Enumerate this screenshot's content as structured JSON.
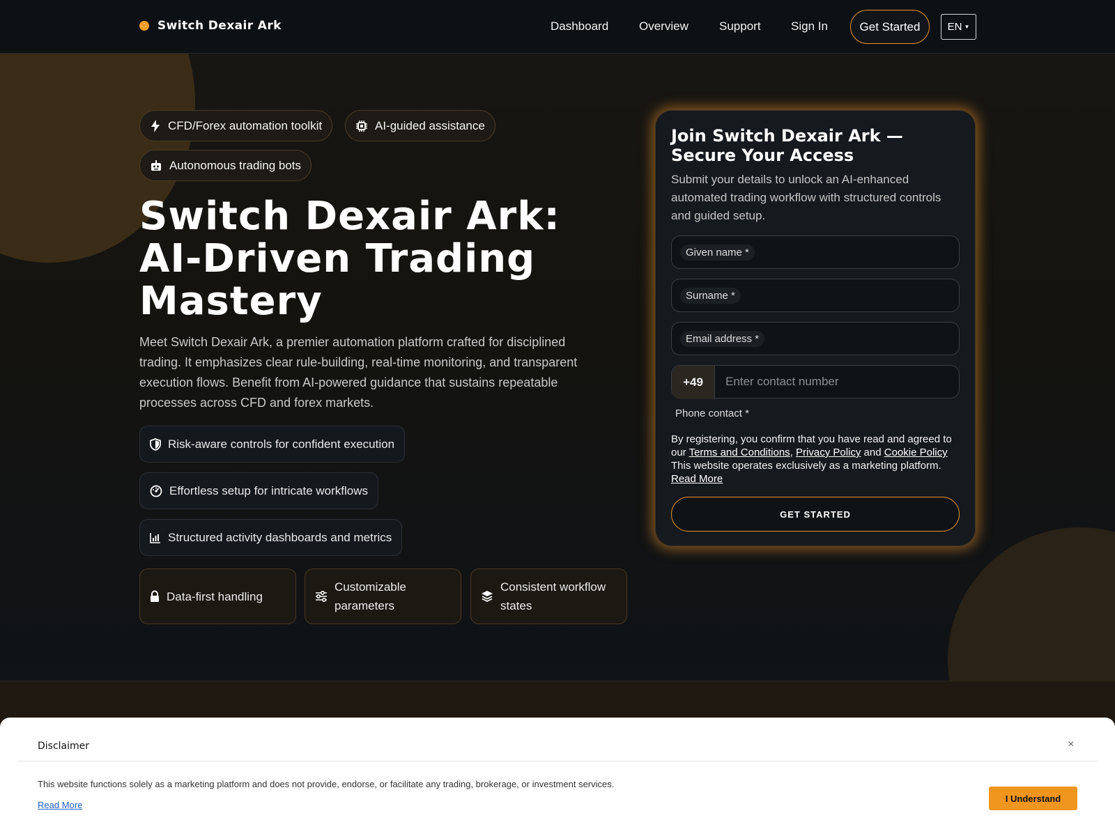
{
  "header": {
    "logo_text": "Switch Dexair Ark",
    "nav": [
      "Dashboard",
      "Overview",
      "Support",
      "Sign In"
    ],
    "cta_label": "Get Started",
    "lang_label": "EN"
  },
  "hero": {
    "badges": [
      "CFD/Forex automation toolkit",
      "AI-guided assistance",
      "Autonomous trading bots"
    ],
    "headline": "Switch Dexair Ark: AI-Driven Trading Mastery",
    "lead": "Meet Switch Dexair Ark, a premier automation platform crafted for disciplined trading. It emphasizes clear rule-building, real-time monitoring, and transparent execution flows. Benefit from AI-powered guidance that sustains repeatable processes across CFD and forex markets.",
    "features": [
      "Risk-aware controls for confident execution",
      "Effortless setup for intricate workflows",
      "Structured activity dashboards and metrics"
    ],
    "tiles": [
      "Data-first handling",
      "Customizable parameters",
      "Consistent workflow states"
    ]
  },
  "form": {
    "title": "Join Switch Dexair Ark — Secure Your Access",
    "subtitle": "Submit your details to unlock an AI-enhanced automated trading workflow with structured controls and guided setup.",
    "given_name_label": "Given name *",
    "surname_label": "Surname *",
    "email_label": "Email address *",
    "phone_prefix": "+49",
    "phone_placeholder": "Enter contact number",
    "phone_label": "Phone contact *",
    "legal_intro": "By registering, you confirm that you have read and agreed to our",
    "terms": "Terms and Conditions",
    "privacy": "Privacy Policy",
    "and": "and",
    "cookie": "Cookie Policy",
    "legal_note": "This website operates exclusively as a marketing platform.",
    "read_more": "Read More",
    "submit_label": "GET STARTED"
  },
  "disclaimer": {
    "title": "Disclaimer",
    "close": "×",
    "text": "This website functions solely as a marketing platform and does not provide, endorse, or facilitate any trading, brokerage, or investment services.",
    "read_more": "Read More",
    "button": "I Understand"
  },
  "colors": {
    "accent": "#f0a02a",
    "background": "#0f1215",
    "card": "#16191d"
  }
}
